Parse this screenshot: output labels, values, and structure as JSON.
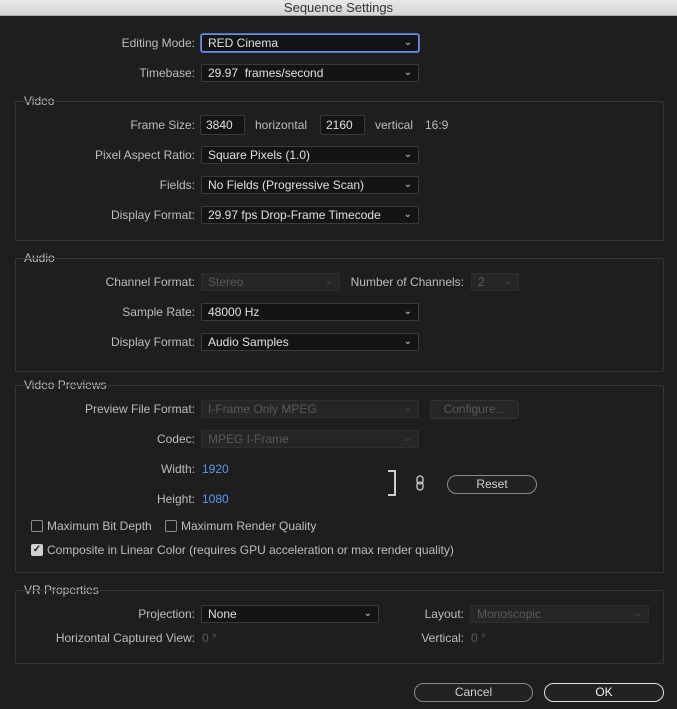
{
  "window": {
    "title": "Sequence Settings"
  },
  "general": {
    "editing_mode_label": "Editing Mode:",
    "editing_mode_value": "RED Cinema",
    "timebase_label": "Timebase:",
    "timebase_value": "29.97  frames/second"
  },
  "video": {
    "section_title": "Video",
    "frame_size_label": "Frame Size:",
    "frame_width": "3840",
    "horizontal_label": "horizontal",
    "frame_height": "2160",
    "vertical_label": "vertical",
    "aspect": "16:9",
    "pixel_aspect_label": "Pixel Aspect Ratio:",
    "pixel_aspect_value": "Square Pixels (1.0)",
    "fields_label": "Fields:",
    "fields_value": "No Fields (Progressive Scan)",
    "display_format_label": "Display Format:",
    "display_format_value": "29.97 fps Drop-Frame Timecode"
  },
  "audio": {
    "section_title": "Audio",
    "channel_format_label": "Channel Format:",
    "channel_format_value": "Stereo",
    "num_channels_label": "Number of Channels:",
    "num_channels_value": "2",
    "sample_rate_label": "Sample Rate:",
    "sample_rate_value": "48000 Hz",
    "display_format_label": "Display Format:",
    "display_format_value": "Audio Samples"
  },
  "previews": {
    "section_title": "Video Previews",
    "preview_format_label": "Preview File Format:",
    "preview_format_value": "I-Frame Only MPEG",
    "configure_label": "Configure...",
    "codec_label": "Codec:",
    "codec_value": "MPEG I-Frame",
    "width_label": "Width:",
    "width_value": "1920",
    "height_label": "Height:",
    "height_value": "1080",
    "reset_label": "Reset",
    "max_bit_depth_label": "Maximum Bit Depth",
    "max_render_quality_label": "Maximum Render Quality",
    "composite_linear_label": "Composite in Linear Color (requires GPU acceleration or max render quality)",
    "composite_linear_checked": true
  },
  "vr": {
    "section_title": "VR Properties",
    "projection_label": "Projection:",
    "projection_value": "None",
    "layout_label": "Layout:",
    "layout_value": "Monoscopic",
    "hcv_label": "Horizontal Captured View:",
    "hcv_value": "0 °",
    "vertical_label": "Vertical:",
    "vertical_value": "0 °"
  },
  "footer": {
    "cancel_label": "Cancel",
    "ok_label": "OK"
  }
}
